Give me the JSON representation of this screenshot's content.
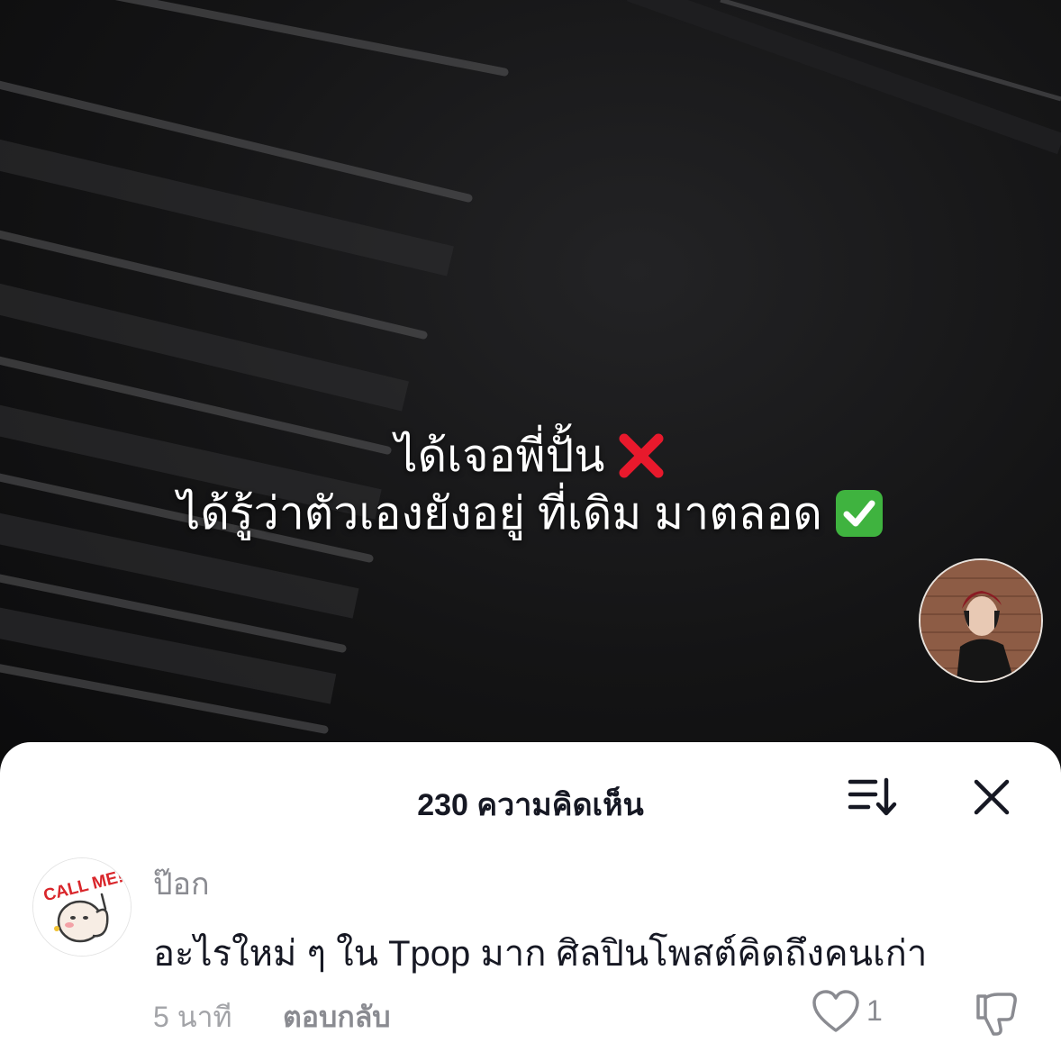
{
  "video": {
    "caption_line1": "ได้เจอพี่ปั้น",
    "caption_line2": "ได้รู้ว่าตัวเองยังอยู่ ที่เดิม มาตลอด",
    "line1_emoji": "cross-mark-icon",
    "line2_emoji": "check-mark-button-icon"
  },
  "comments_sheet": {
    "title": "230 ความคิดเห็น",
    "sort_icon": "sort-icon",
    "close_icon": "close-icon"
  },
  "comment": {
    "username": "ป๊อก",
    "avatar_sticker_text": "CALL ME!",
    "text": "อะไรใหม่ ๆ ใน Tpop มาก ศิลปินโพสต์คิดถึงคนเก่า",
    "time": "5 นาที",
    "reply_label": "ตอบกลับ",
    "like_count": "1"
  },
  "colors": {
    "sheet_bg": "#ffffff",
    "primary_text": "#161823",
    "secondary_text": "#8a8b91",
    "cross_red": "#e8192c",
    "check_green": "#3fb33f"
  }
}
